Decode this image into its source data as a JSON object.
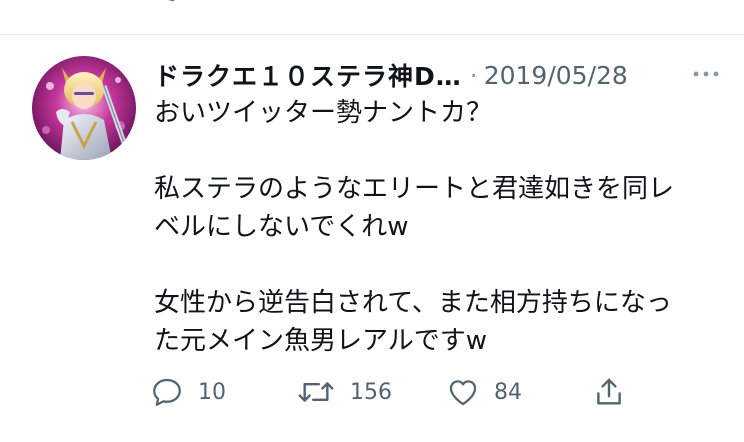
{
  "tweet": {
    "display_name": "ドラクエ１０ステラ神D…",
    "separator": "·",
    "date": "2019/05/28",
    "body_lines": [
      "おいツイッター勢ナントカ？",
      "",
      "私ステラのようなエリートと君達如きを同レ",
      "ベルにしないでくれw",
      "",
      "女性から逆告白されて、また相方持ちになっ",
      "た元メイン魚男レアルですw"
    ],
    "actions": {
      "reply_count": "10",
      "retweet_count": "156",
      "like_count": "84"
    }
  },
  "colors": {
    "text": "#0f1419",
    "secondary": "#536471",
    "divider": "#e6ecf0"
  },
  "icons": {
    "reply": "reply-icon",
    "retweet": "retweet-icon",
    "like": "heart-icon",
    "share": "share-icon",
    "more": "more-icon"
  }
}
